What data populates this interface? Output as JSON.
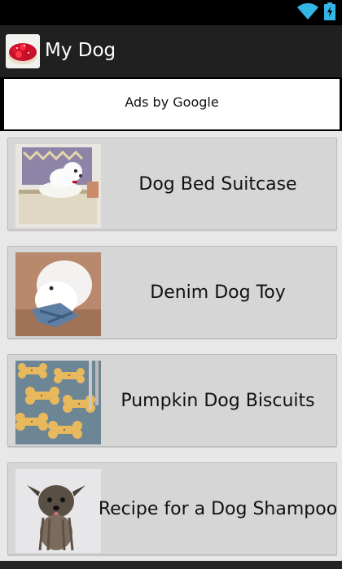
{
  "app": {
    "title": "My Dog",
    "icon": "strawberry-cake-icon"
  },
  "status_bar": {
    "icons": [
      "wifi-icon",
      "battery-icon"
    ],
    "accent": "#33b5e5"
  },
  "ad_banner": {
    "text": "Ads by Google"
  },
  "items": [
    {
      "label": "Dog Bed Suitcase",
      "thumbnail": "dog-in-suitcase-image"
    },
    {
      "label": "Denim Dog Toy",
      "thumbnail": "white-dog-with-denim-toy-image"
    },
    {
      "label": "Pumpkin Dog Biscuits",
      "thumbnail": "bone-shaped-biscuits-image"
    },
    {
      "label": "Recipe for a Dog Shampoo",
      "thumbnail": "wet-small-dog-image"
    }
  ]
}
